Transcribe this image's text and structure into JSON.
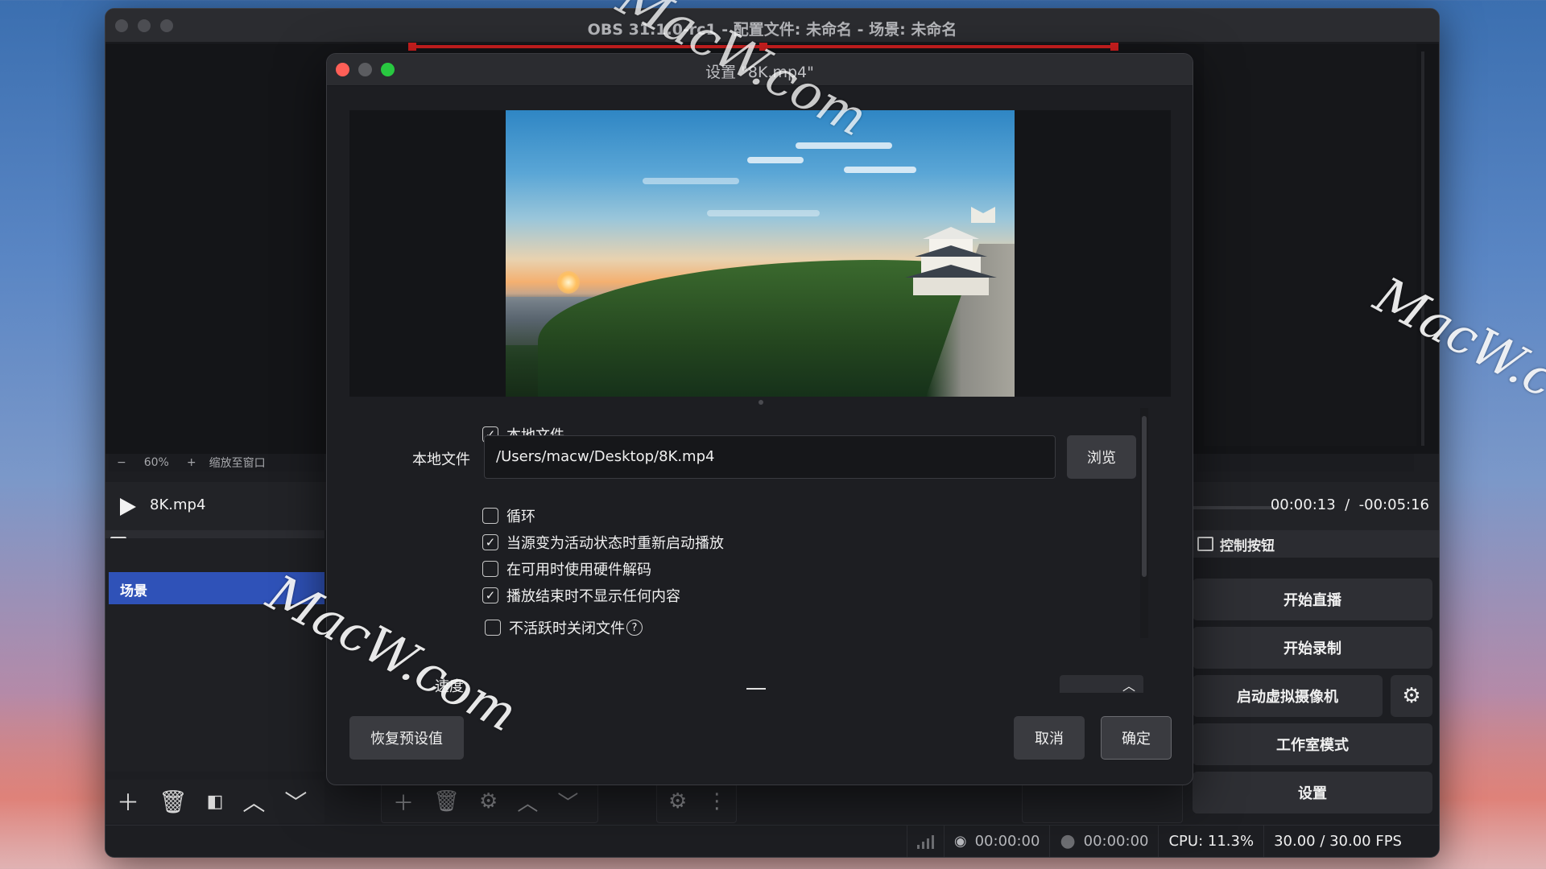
{
  "main_window": {
    "title": "OBS 31.1.0-rc1 - 配置文件: 未命名 - 场景: 未命名"
  },
  "zoom": {
    "minus": "−",
    "level": "60%",
    "plus": "+",
    "fit": "缩放至窗口"
  },
  "media": {
    "name": "8K.mp4",
    "elapsed": "00:00:13",
    "separator": "/",
    "remaining": "-00:05:16"
  },
  "scenes": {
    "title": "场景",
    "items": [
      "场景"
    ]
  },
  "controls": {
    "title": "控制按钮",
    "start_stream": "开始直播",
    "start_record": "开始录制",
    "virtual_cam": "启动虚拟摄像机",
    "studio_mode": "工作室模式",
    "settings": "设置"
  },
  "status": {
    "stream_time": "00:00:00",
    "record_time": "00:00:00",
    "cpu": "CPU: 11.3%",
    "fps": "30.00 / 30.00 FPS"
  },
  "dialog": {
    "title": "设置 \"8K.mp4\"",
    "local_file_checkbox": "本地文件",
    "local_file_checked": true,
    "local_file_label": "本地文件",
    "path_value": "/Users/macw/Desktop/8K.mp4",
    "browse": "浏览",
    "options": [
      {
        "label": "循环",
        "checked": false
      },
      {
        "label": "当源变为活动状态时重新启动播放",
        "checked": true
      },
      {
        "label": "在可用时使用硬件解码",
        "checked": false
      },
      {
        "label": "播放结束时不显示任何内容",
        "checked": true
      },
      {
        "label": "不活跃时关闭文件",
        "checked": false
      }
    ],
    "help_glyph": "?",
    "speed_label": "速度",
    "restore_defaults": "恢复预设值",
    "cancel": "取消",
    "ok": "确定"
  },
  "watermarks": [
    "MacW.com",
    "MacW.com",
    "MacW.c"
  ],
  "colors": {
    "close": "#ff5f57",
    "minimize": "#5b5c60",
    "zoom": "#28c840",
    "scene_selected": "#2f52b8",
    "red_guide": "#d62020"
  }
}
